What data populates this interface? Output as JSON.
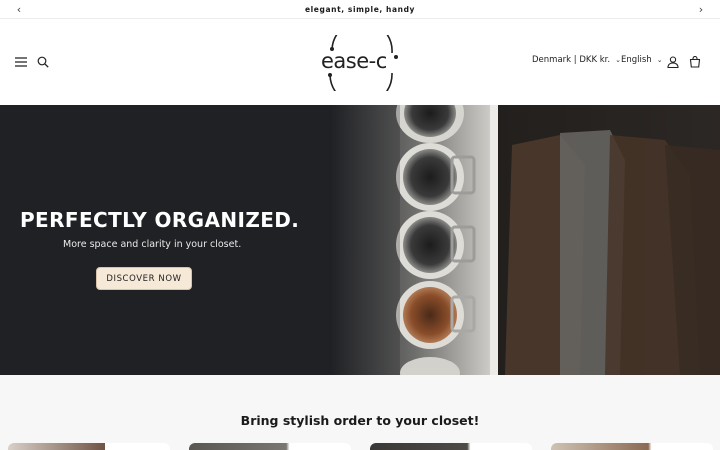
{
  "announcement": {
    "text": "elegant, simple, handy",
    "prev_icon": "chevron-left-icon",
    "next_icon": "chevron-right-icon"
  },
  "header": {
    "logo_text": "ease-c",
    "country_selector": "Denmark | DKK kr.",
    "language_selector": "English",
    "icons": [
      "menu-icon",
      "search-icon",
      "account-icon",
      "cart-icon"
    ]
  },
  "hero": {
    "title": "PERFECTLY ORGANIZED.",
    "subtitle": "More space and clarity in your closet.",
    "button_label": "DISCOVER NOW"
  },
  "section": {
    "title": "Bring stylish order to your closet!"
  },
  "colors": {
    "hero_bg": "#1f2124",
    "button_bg": "#f6e9d8",
    "section_bg": "#f7f7f7"
  }
}
